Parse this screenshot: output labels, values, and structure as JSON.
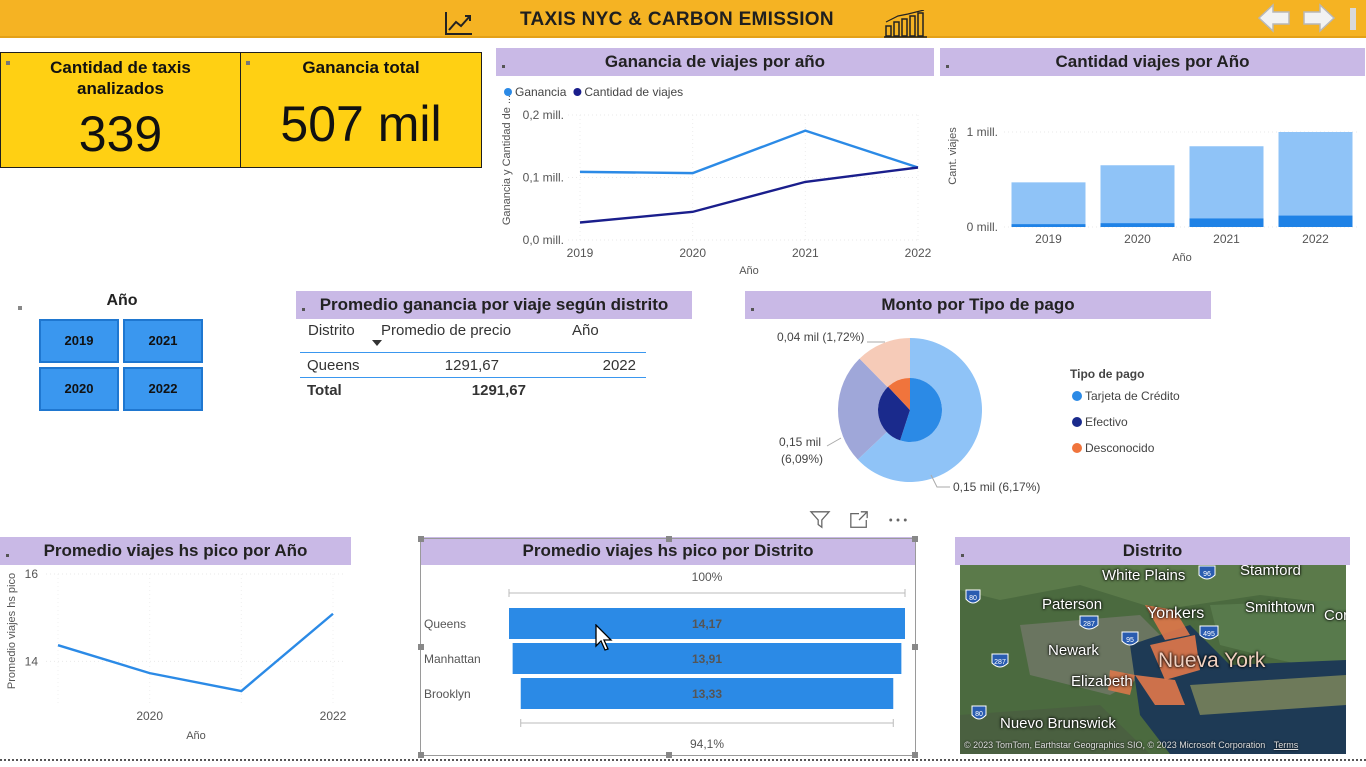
{
  "header": {
    "title": "TAXIS NYC & CARBON EMISSION",
    "line_icon": "line-chart-icon",
    "bars_icon": "bar-chart-icon",
    "nav_back_icon": "arrow-left-icon",
    "nav_forward_icon": "arrow-right-icon"
  },
  "kpis": [
    {
      "label": "Cantidad de taxis analizados",
      "value": "339"
    },
    {
      "label": "Ganancia total",
      "value": "507 mil"
    }
  ],
  "panels": {
    "ganancia_anual": "Ganancia de viajes por año",
    "viajes_anual": "Cantidad viajes por Año",
    "promedio_distrito_tabla": "Promedio ganancia por viaje según distrito",
    "monto_pago": "Monto por Tipo de pago",
    "pico_anual": "Promedio viajes hs pico por Año",
    "pico_distrito": "Promedio viajes hs pico por Distrito",
    "distrito_mapa": "Distrito"
  },
  "slicer": {
    "title": "Año",
    "options": [
      "2019",
      "2021",
      "2020",
      "2022"
    ]
  },
  "table": {
    "columns": [
      "Distrito",
      "Promedio de precio",
      "Año"
    ],
    "sort_icon": "sort-down-icon",
    "rows": [
      {
        "distrito": "Queens",
        "precio": "1291,67",
        "anio": "2022"
      }
    ],
    "total_label": "Total",
    "total_value": "1291,67"
  },
  "visual_toolbar": {
    "filter_icon": "filter-icon",
    "focus_icon": "focus-mode-icon",
    "more_icon": "more-options-icon"
  },
  "map": {
    "labels": [
      "White Plains",
      "Stamford",
      "Paterson",
      "Yonkers",
      "Smithtown",
      "Cor",
      "Newark",
      "Nueva York",
      "Elizabeth",
      "Nuevo Brunswick"
    ],
    "route_shields": [
      "80",
      "96",
      "287",
      "95",
      "495",
      "287",
      "80"
    ],
    "copyright": "© 2023 TomTom, Earthstar Geographics SIO, © 2023 Microsoft Corporation",
    "terms": "Terms"
  },
  "chart_data": [
    {
      "type": "line",
      "title": "Ganancia de viajes por año",
      "x": [
        "2019",
        "2020",
        "2021",
        "2022"
      ],
      "xlabel": "Año",
      "ylabel": "Ganancia y Cantidad de ...",
      "y_ticks": [
        "0,0 mill.",
        "0,1 mill.",
        "0,2 mill."
      ],
      "ylim": [
        0,
        0.2
      ],
      "legend": "top-left",
      "series": [
        {
          "name": "Ganancia",
          "color": "#2b8ae6",
          "values": [
            0.109,
            0.107,
            0.175,
            0.116
          ]
        },
        {
          "name": "Cantidad de viajes",
          "color": "#1a1e8c",
          "values": [
            0.028,
            0.045,
            0.093,
            0.116
          ]
        }
      ]
    },
    {
      "type": "bar",
      "title": "Cantidad viajes por Año",
      "categories": [
        "2019",
        "2020",
        "2021",
        "2022"
      ],
      "xlabel": "Año",
      "ylabel": "Cant. viajes",
      "y_ticks": [
        "0 mill.",
        "1 mill."
      ],
      "ylim": [
        0,
        1
      ],
      "series": [
        {
          "color": "#8fc3f7",
          "values": [
            0.47,
            0.65,
            0.85,
            1.0
          ]
        },
        {
          "color": "#1f82e6",
          "values": [
            0.03,
            0.04,
            0.09,
            0.12
          ]
        }
      ]
    },
    {
      "type": "pie",
      "title": "Monto por Tipo de pago",
      "legend_title": "Tipo de pago",
      "legend": "right",
      "legend_entries": [
        {
          "name": "Tarjeta de Crédito",
          "color": "#2b8ae6"
        },
        {
          "name": "Efectivo",
          "color": "#1a2a8c"
        },
        {
          "name": "Desconocido",
          "color": "#f0743c"
        }
      ],
      "slices": [
        {
          "label": "",
          "value": 56,
          "color": "#8fc3f7"
        },
        {
          "label": "0,15 mil (6,09%)",
          "value": 22,
          "color": "#9fa7d9"
        },
        {
          "label": "0,04 mil (1,72%)",
          "value": 11,
          "color": "#f6cbb8"
        }
      ],
      "inner_slices": [
        {
          "value": 55,
          "color": "#2b8ae6"
        },
        {
          "value": 33,
          "color": "#1a2a8c"
        },
        {
          "value": 12,
          "color": "#f0743c"
        }
      ],
      "annotations": [
        "0,04 mil (1,72%)",
        "0,15 mil",
        "(6,09%)",
        "0,15 mil (6,17%)"
      ]
    },
    {
      "type": "line",
      "title": "Promedio viajes hs pico por Año",
      "x": [
        "2019",
        "2020",
        "2021",
        "2022"
      ],
      "x_ticks": [
        "2020",
        "2022"
      ],
      "xlabel": "Año",
      "ylabel": "Promedio viajes hs pico",
      "y_ticks": [
        "14",
        "16"
      ],
      "ylim": [
        13,
        16
      ],
      "series": [
        {
          "color": "#2b8ae6",
          "values": [
            14.37,
            13.73,
            13.32,
            15.09
          ]
        }
      ]
    },
    {
      "type": "bar",
      "orientation": "horizontal",
      "title": "Promedio viajes hs pico por Distrito",
      "categories": [
        "Queens",
        "Manhattan",
        "Brooklyn"
      ],
      "values": [
        14.17,
        13.91,
        13.33
      ],
      "value_labels": [
        "14,17",
        "13,91",
        "13,33"
      ],
      "top_label": "100%",
      "bottom_label": "94,1%",
      "color": "#2b8ae6"
    }
  ]
}
